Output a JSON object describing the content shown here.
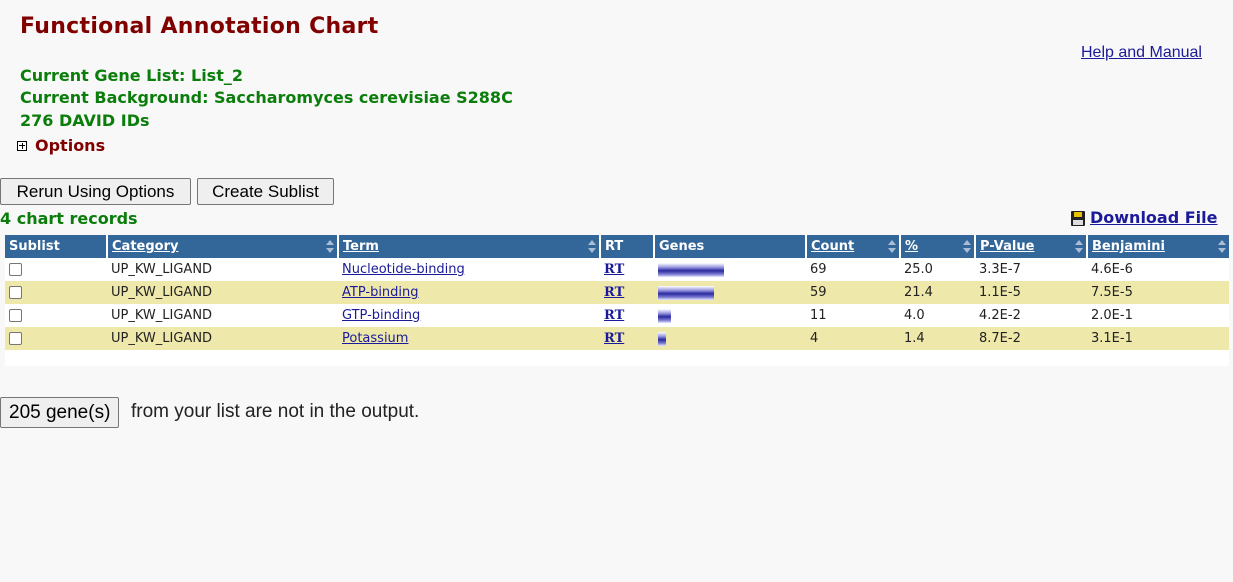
{
  "page": {
    "title": "Functional Annotation Chart",
    "help_link": "Help and Manual",
    "gene_list": "Current Gene List: List_2",
    "background": "Current Background: Saccharomyces cerevisiae S288C",
    "david_ids": "276 DAVID IDs",
    "options_label": "Options"
  },
  "buttons": {
    "rerun": "Rerun Using Options",
    "create_sublist": "Create Sublist"
  },
  "records_label": "4 chart records",
  "download_label": "Download File",
  "table": {
    "headers": [
      "Sublist",
      "Category",
      "Term",
      "RT",
      "Genes",
      "Count",
      "%",
      "P-Value",
      "Benjamini"
    ],
    "rows": [
      {
        "category": "UP_KW_LIGAND",
        "term": "Nucleotide-binding",
        "rt": "RT",
        "count": "69",
        "percent": "25.0",
        "pvalue": "3.3E-7",
        "benjamini": "4.6E-6",
        "gene_bar_fraction": 1.0
      },
      {
        "category": "UP_KW_LIGAND",
        "term": "ATP-binding",
        "rt": "RT",
        "count": "59",
        "percent": "21.4",
        "pvalue": "1.1E-5",
        "benjamini": "7.5E-5",
        "gene_bar_fraction": 0.855
      },
      {
        "category": "UP_KW_LIGAND",
        "term": "GTP-binding",
        "rt": "RT",
        "count": "11",
        "percent": "4.0",
        "pvalue": "4.2E-2",
        "benjamini": "2.0E-1",
        "gene_bar_fraction": 0.2
      },
      {
        "category": "UP_KW_LIGAND",
        "term": "Potassium",
        "rt": "RT",
        "count": "4",
        "percent": "1.4",
        "pvalue": "8.7E-2",
        "benjamini": "3.1E-1",
        "gene_bar_fraction": 0.12
      }
    ]
  },
  "footer": {
    "genes_button": "205 gene(s)",
    "genes_text": "from your list are not in the output."
  },
  "colors": {
    "title": "#800000",
    "info_green": "#0b7d0b",
    "header_bg": "#336699",
    "row_alt": "#eee8aa",
    "link": "#1a1a9a"
  }
}
